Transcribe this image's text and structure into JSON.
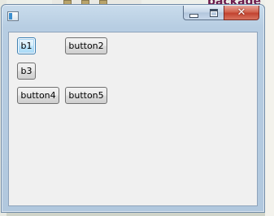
{
  "window": {
    "title": "",
    "close_glyph": "✕"
  },
  "background": {
    "package_text": "package c"
  },
  "buttons": [
    {
      "label": "b1"
    },
    {
      "label": "button2"
    },
    {
      "label": "b3"
    },
    {
      "label": "button4"
    },
    {
      "label": "button5"
    }
  ]
}
